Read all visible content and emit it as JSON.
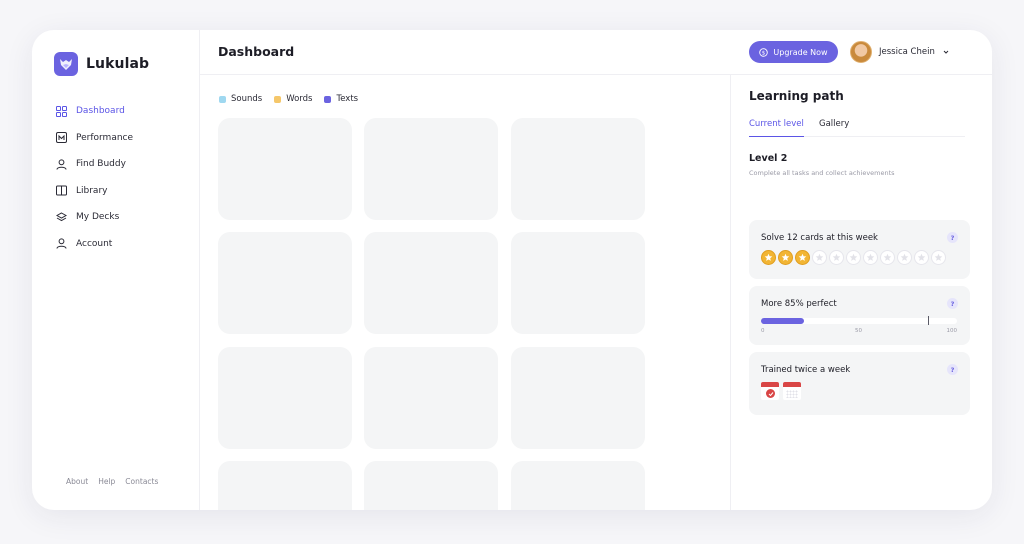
{
  "app": {
    "name": "Lukulab",
    "accent": "#6b63e0"
  },
  "sidebar": {
    "items": [
      {
        "label": "Dashboard",
        "icon": "grid-icon",
        "active": true
      },
      {
        "label": "Performance",
        "icon": "chart-icon"
      },
      {
        "label": "Find Buddy",
        "icon": "user-icon"
      },
      {
        "label": "Library",
        "icon": "book-icon"
      },
      {
        "label": "My Decks",
        "icon": "layers-icon"
      },
      {
        "label": "Account",
        "icon": "user-icon"
      }
    ],
    "footer": [
      "About",
      "Help",
      "Contacts"
    ]
  },
  "header": {
    "title": "Dashboard",
    "upgrade_label": "Upgrade Now",
    "user_name": "Jessica Chein"
  },
  "legend": [
    {
      "label": "Sounds",
      "color": "#9fd8f0"
    },
    {
      "label": "Words",
      "color": "#f5c76a"
    },
    {
      "label": "Texts",
      "color": "#6b63e0"
    }
  ],
  "panel": {
    "title": "Learning path",
    "tabs": [
      "Current level",
      "Gallery"
    ],
    "level": "Level 2",
    "level_sub": "Complete all tasks and collect achievements",
    "tasks": [
      {
        "title": "Solve 12 cards at this week",
        "stars_total": 11,
        "stars_done": 3
      },
      {
        "title": "More 85% perfect",
        "progress": 22,
        "target": 85,
        "ticks": [
          "0",
          "50",
          "100"
        ]
      },
      {
        "title": "Trained twice a week",
        "days_done": 1,
        "days_total": 2
      }
    ],
    "help_label": "?"
  }
}
